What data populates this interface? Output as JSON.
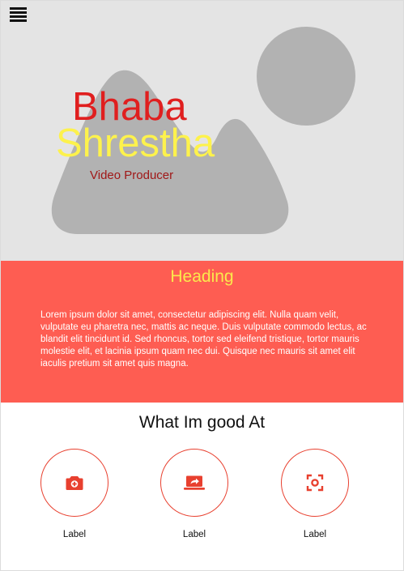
{
  "hero": {
    "first_name": "Bhaba",
    "last_name": "Shrestha",
    "role": "Video Producer",
    "menu_icon": "hamburger-menu-icon",
    "colors": {
      "background": "#e4e4e4",
      "placeholder_shape": "#b2b2b2",
      "first_name": "#e01f1f",
      "last_name": "#fdf24c",
      "role": "#a01818"
    }
  },
  "about": {
    "heading": "Heading",
    "body": "Lorem ipsum dolor sit amet, consectetur adipiscing elit. Nulla quam velit, vulputate eu pharetra nec, mattis ac neque. Duis vulputate commodo lectus, ac blandit elit tincidunt id. Sed rhoncus, tortor sed eleifend tristique, tortor mauris molestie elit, et lacinia ipsum quam nec dui. Quisque nec mauris sit amet elit iaculis pretium sit amet quis magna.",
    "colors": {
      "background": "#fe5d52",
      "heading": "#fbe94c",
      "text": "#ffffff"
    }
  },
  "skills": {
    "heading": "What Im good At",
    "accent": "#e8402f",
    "items": [
      {
        "label": "Label",
        "icon": "add-a-photo-icon"
      },
      {
        "label": "Label",
        "icon": "laptop-share-icon"
      },
      {
        "label": "Label",
        "icon": "center-focus-icon"
      }
    ]
  }
}
